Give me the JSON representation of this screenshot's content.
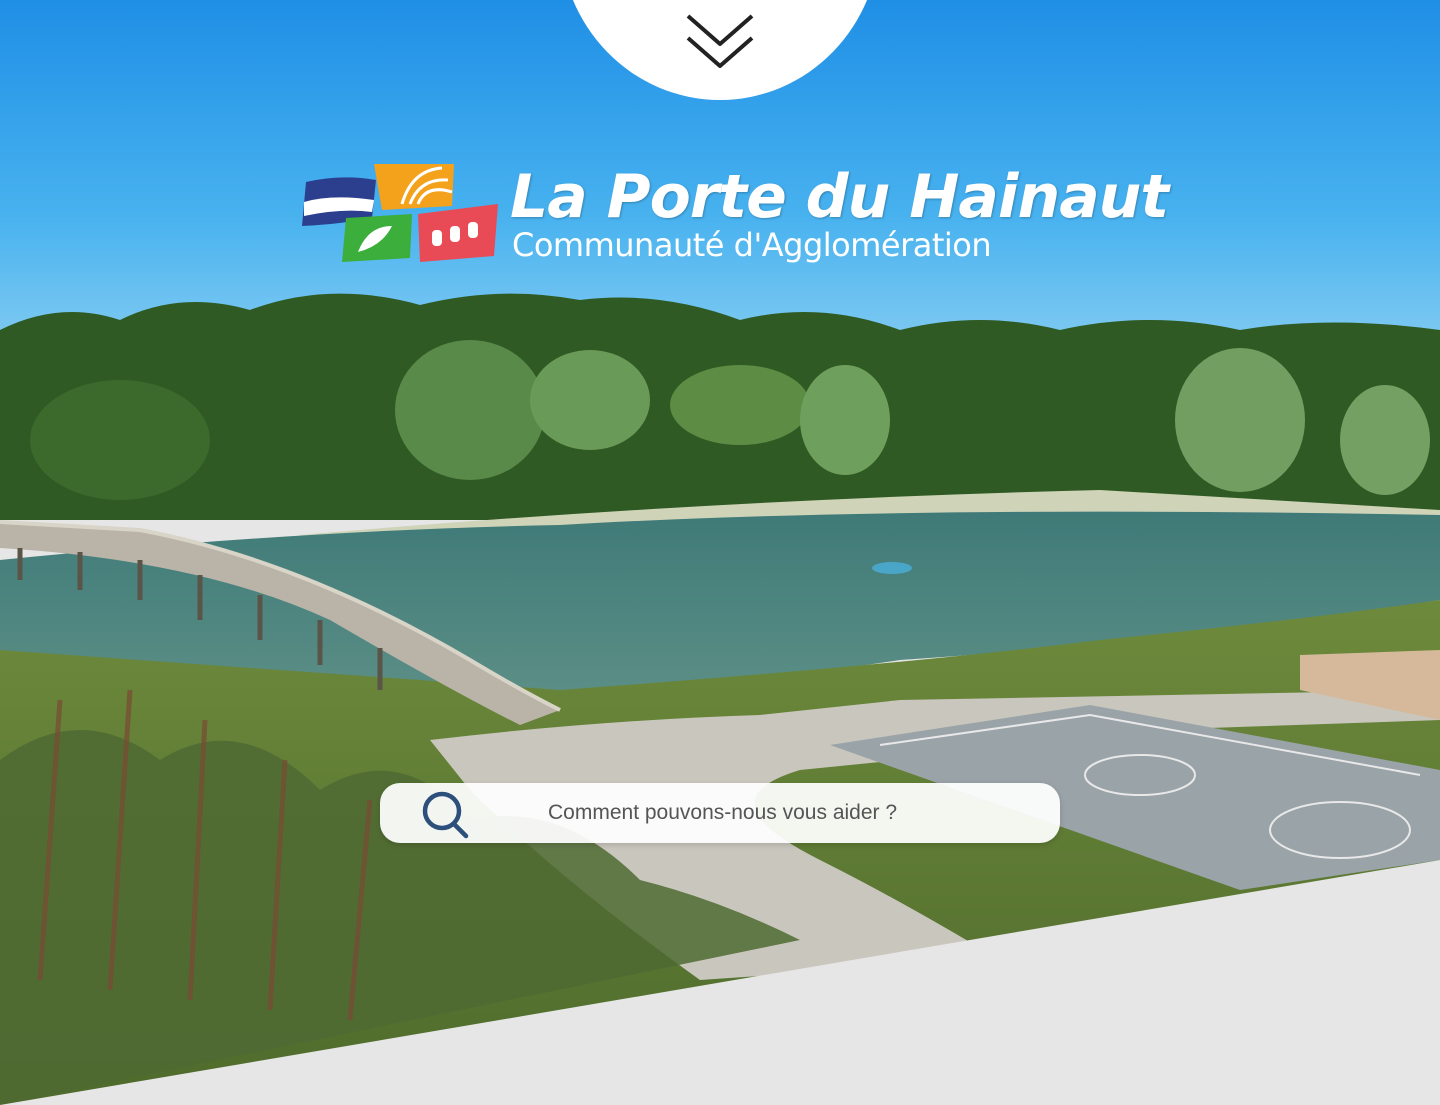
{
  "brand": {
    "title": "La Porte du Hainaut",
    "subtitle": "Communauté d'Agglomération"
  },
  "search": {
    "placeholder": "Comment pouvons-nous vous aider ?",
    "value": ""
  },
  "icons": {
    "scroll": "double-chevron-down-icon",
    "search": "magnifier-icon"
  },
  "colors": {
    "accent": "#2c4f7c",
    "sky": "#2d9fe8",
    "bottom_section": "#e6e6e6"
  }
}
